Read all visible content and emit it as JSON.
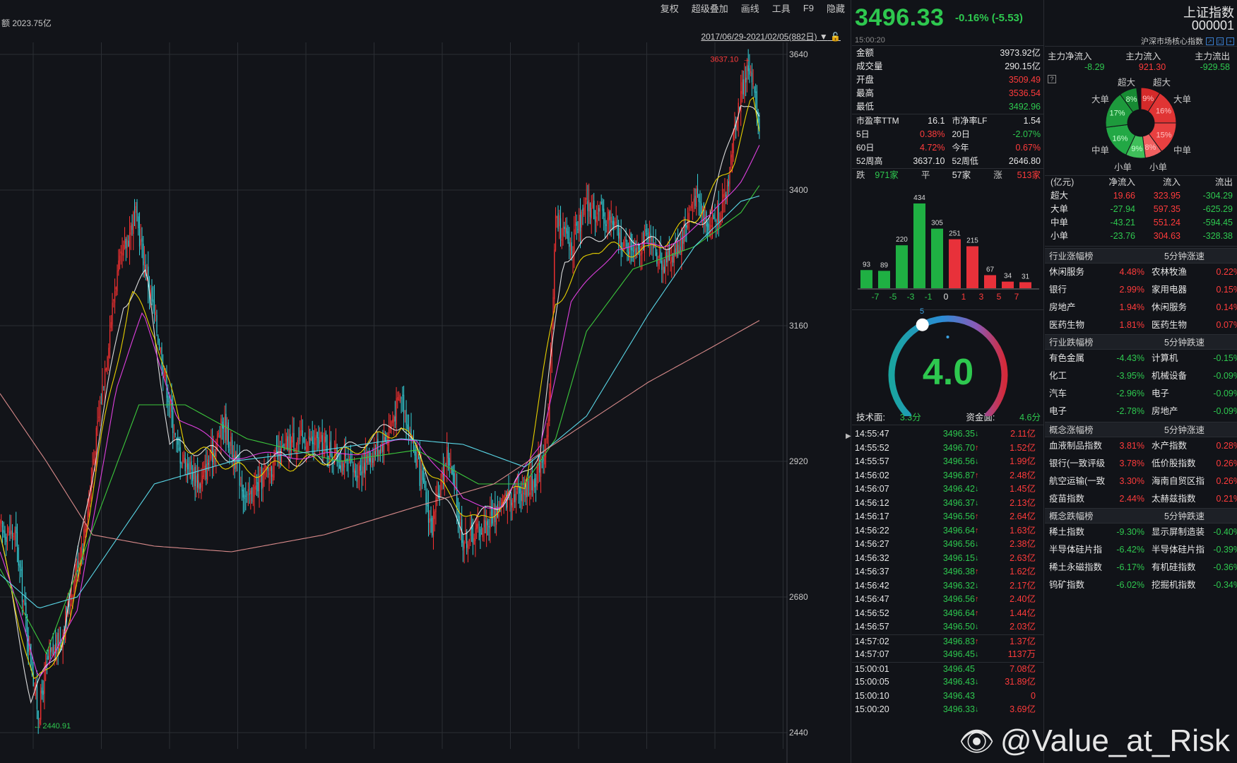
{
  "toolbar": {
    "items": [
      "复权",
      "超级叠加",
      "画线",
      "工具",
      "F9",
      "隐藏"
    ]
  },
  "chart_info": "额 2023.75亿",
  "date_range": "2017/06/29-2021/02/05(882日)",
  "chart_data": {
    "type": "candlestick",
    "y_ticks": [
      3640,
      3400,
      3160,
      2920,
      2680,
      2440
    ],
    "ylim": [
      2440,
      3640
    ],
    "high_label": "3637.10",
    "low_label": "2440.91",
    "close_path_anchors": [
      [
        0,
        2800
      ],
      [
        20,
        2790
      ],
      [
        35,
        2620
      ],
      [
        50,
        2470
      ],
      [
        60,
        2560
      ],
      [
        80,
        2610
      ],
      [
        110,
        2800
      ],
      [
        150,
        3240
      ],
      [
        175,
        3360
      ],
      [
        200,
        3180
      ],
      [
        230,
        2940
      ],
      [
        260,
        2880
      ],
      [
        290,
        2990
      ],
      [
        320,
        2850
      ],
      [
        345,
        2900
      ],
      [
        380,
        2960
      ],
      [
        420,
        2950
      ],
      [
        460,
        2900
      ],
      [
        500,
        2960
      ],
      [
        520,
        3040
      ],
      [
        540,
        2920
      ],
      [
        560,
        2800
      ],
      [
        580,
        2940
      ],
      [
        600,
        2780
      ],
      [
        630,
        2810
      ],
      [
        660,
        2860
      ],
      [
        690,
        2880
      ],
      [
        710,
        2960
      ],
      [
        720,
        3350
      ],
      [
        740,
        3300
      ],
      [
        760,
        3370
      ],
      [
        790,
        3350
      ],
      [
        810,
        3300
      ],
      [
        840,
        3310
      ],
      [
        860,
        3270
      ],
      [
        880,
        3300
      ],
      [
        900,
        3390
      ],
      [
        920,
        3340
      ],
      [
        940,
        3380
      ],
      [
        955,
        3540
      ],
      [
        970,
        3620
      ],
      [
        985,
        3510
      ]
    ],
    "ma_lines": [
      {
        "color": "#ffffff",
        "anchors": [
          [
            0,
            2790
          ],
          [
            40,
            2500
          ],
          [
            80,
            2600
          ],
          [
            120,
            2900
          ],
          [
            160,
            3200
          ],
          [
            190,
            3250
          ],
          [
            220,
            2950
          ],
          [
            300,
            2930
          ],
          [
            420,
            2920
          ],
          [
            520,
            2990
          ],
          [
            560,
            2880
          ],
          [
            600,
            2800
          ],
          [
            660,
            2860
          ],
          [
            700,
            2940
          ],
          [
            730,
            3280
          ],
          [
            790,
            3330
          ],
          [
            860,
            3300
          ],
          [
            920,
            3360
          ],
          [
            960,
            3560
          ],
          [
            985,
            3520
          ]
        ]
      },
      {
        "color": "#e8d100",
        "anchors": [
          [
            0,
            2780
          ],
          [
            45,
            2520
          ],
          [
            90,
            2620
          ],
          [
            130,
            2950
          ],
          [
            170,
            3220
          ],
          [
            200,
            3150
          ],
          [
            240,
            2950
          ],
          [
            320,
            2900
          ],
          [
            440,
            2930
          ],
          [
            520,
            2980
          ],
          [
            580,
            2860
          ],
          [
            620,
            2810
          ],
          [
            680,
            2880
          ],
          [
            720,
            3200
          ],
          [
            770,
            3300
          ],
          [
            840,
            3290
          ],
          [
            900,
            3350
          ],
          [
            950,
            3450
          ],
          [
            975,
            3560
          ],
          [
            985,
            3500
          ]
        ]
      },
      {
        "color": "#e040e0",
        "anchors": [
          [
            0,
            2760
          ],
          [
            50,
            2540
          ],
          [
            100,
            2650
          ],
          [
            150,
            3050
          ],
          [
            185,
            3180
          ],
          [
            230,
            3000
          ],
          [
            300,
            2930
          ],
          [
            440,
            2930
          ],
          [
            540,
            2960
          ],
          [
            600,
            2850
          ],
          [
            650,
            2840
          ],
          [
            700,
            2950
          ],
          [
            740,
            3200
          ],
          [
            800,
            3300
          ],
          [
            860,
            3300
          ],
          [
            920,
            3350
          ],
          [
            960,
            3420
          ],
          [
            985,
            3480
          ]
        ]
      },
      {
        "color": "#3cc83c",
        "anchors": [
          [
            0,
            2730
          ],
          [
            60,
            2580
          ],
          [
            120,
            2800
          ],
          [
            180,
            3020
          ],
          [
            240,
            3020
          ],
          [
            320,
            2960
          ],
          [
            440,
            2920
          ],
          [
            540,
            2940
          ],
          [
            620,
            2880
          ],
          [
            680,
            2880
          ],
          [
            720,
            2960
          ],
          [
            760,
            3150
          ],
          [
            820,
            3260
          ],
          [
            900,
            3300
          ],
          [
            960,
            3360
          ],
          [
            985,
            3410
          ]
        ]
      },
      {
        "color": "#5ad8e8",
        "anchors": [
          [
            0,
            2720
          ],
          [
            50,
            2660
          ],
          [
            100,
            2680
          ],
          [
            200,
            2880
          ],
          [
            300,
            2920
          ],
          [
            420,
            2940
          ],
          [
            520,
            2960
          ],
          [
            600,
            2950
          ],
          [
            680,
            2910
          ],
          [
            760,
            3000
          ],
          [
            840,
            3180
          ],
          [
            900,
            3300
          ],
          [
            960,
            3380
          ],
          [
            985,
            3390
          ]
        ]
      },
      {
        "color": "#d88a8a",
        "anchors": [
          [
            0,
            3040
          ],
          [
            60,
            2920
          ],
          [
            120,
            2790
          ],
          [
            200,
            2770
          ],
          [
            300,
            2760
          ],
          [
            420,
            2790
          ],
          [
            540,
            2840
          ],
          [
            640,
            2880
          ],
          [
            740,
            2970
          ],
          [
            840,
            3060
          ],
          [
            920,
            3120
          ],
          [
            985,
            3170
          ]
        ]
      }
    ]
  },
  "quote": {
    "price": "3496.33",
    "change": "-0.16% (-5.53)",
    "time": "15:00:20",
    "name": "上证指数",
    "code": "000001",
    "subtitle": "沪深市场核心指数"
  },
  "stats": [
    {
      "label": "金额",
      "value": "3973.92亿",
      "color": "white"
    },
    {
      "label": "成交量",
      "value": "290.15亿",
      "color": "white"
    },
    {
      "label": "开盘",
      "value": "3509.49",
      "color": "red"
    },
    {
      "label": "最高",
      "value": "3536.54",
      "color": "red"
    },
    {
      "label": "最低",
      "value": "3492.96",
      "color": "green"
    }
  ],
  "stats2": [
    [
      {
        "label": "市盈率TTM",
        "value": "16.1",
        "color": "white"
      },
      {
        "label": "市净率LF",
        "value": "1.54",
        "color": "white"
      }
    ],
    [
      {
        "label": "5日",
        "value": "0.38%",
        "color": "red"
      },
      {
        "label": "20日",
        "value": "-2.07%",
        "color": "green"
      }
    ],
    [
      {
        "label": "60日",
        "value": "4.72%",
        "color": "red"
      },
      {
        "label": "今年",
        "value": "0.67%",
        "color": "red"
      }
    ],
    [
      {
        "label": "52周高",
        "value": "3637.10",
        "color": "white"
      },
      {
        "label": "52周低",
        "value": "2646.80",
        "color": "white"
      }
    ]
  ],
  "breadth": {
    "down_label": "跌",
    "down": "971家",
    "flat_label": "平",
    "flat": "57家",
    "up_label": "涨",
    "up": "513家"
  },
  "distribution": {
    "values": [
      93,
      89,
      220,
      434,
      305,
      251,
      215,
      67,
      34,
      31
    ],
    "colors": [
      "green",
      "green",
      "green",
      "green",
      "green",
      "red",
      "red",
      "red",
      "red",
      "red"
    ],
    "axis_labels": [
      "-7",
      "-5",
      "-3",
      "-1",
      "0",
      "1",
      "3",
      "5",
      "7"
    ]
  },
  "gauge": {
    "value": "4.0",
    "min": "0",
    "max": "10",
    "mid": "5",
    "level": 4.0,
    "tech_label": "技术面:",
    "tech_value": "3.3分",
    "fund_label": "资金面:",
    "fund_value": "4.6分"
  },
  "ticks": [
    {
      "time": "14:55:47",
      "price": "3496.35",
      "dir": "down",
      "vol": "2.11亿"
    },
    {
      "time": "14:55:52",
      "price": "3496.70",
      "dir": "up",
      "vol": "1.52亿"
    },
    {
      "time": "14:55:57",
      "price": "3496.56",
      "dir": "down",
      "vol": "1.99亿"
    },
    {
      "time": "14:56:02",
      "price": "3496.87",
      "dir": "up",
      "vol": "2.48亿"
    },
    {
      "time": "14:56:07",
      "price": "3496.42",
      "dir": "down",
      "vol": "1.45亿"
    },
    {
      "time": "14:56:12",
      "price": "3496.37",
      "dir": "down",
      "vol": "2.13亿"
    },
    {
      "time": "14:56:17",
      "price": "3496.56",
      "dir": "up",
      "vol": "2.64亿"
    },
    {
      "time": "14:56:22",
      "price": "3496.64",
      "dir": "up",
      "vol": "1.63亿"
    },
    {
      "time": "14:56:27",
      "price": "3496.56",
      "dir": "down",
      "vol": "2.38亿"
    },
    {
      "time": "14:56:32",
      "price": "3496.15",
      "dir": "down",
      "vol": "2.63亿"
    },
    {
      "time": "14:56:37",
      "price": "3496.38",
      "dir": "up",
      "vol": "1.62亿"
    },
    {
      "time": "14:56:42",
      "price": "3496.32",
      "dir": "down",
      "vol": "2.17亿"
    },
    {
      "time": "14:56:47",
      "price": "3496.56",
      "dir": "up",
      "vol": "2.40亿"
    },
    {
      "time": "14:56:52",
      "price": "3496.64",
      "dir": "up",
      "vol": "1.44亿"
    },
    {
      "time": "14:56:57",
      "price": "3496.50",
      "dir": "down",
      "vol": "2.03亿"
    },
    {
      "time": "14:57:02",
      "price": "3496.83",
      "dir": "up",
      "vol": "1.37亿"
    },
    {
      "time": "14:57:07",
      "price": "3496.45",
      "dir": "down",
      "vol": "1137万"
    },
    {
      "time": "15:00:01",
      "price": "3496.45",
      "dir": "",
      "vol": "7.08亿"
    },
    {
      "time": "15:00:05",
      "price": "3496.43",
      "dir": "down",
      "vol": "31.89亿"
    },
    {
      "time": "15:00:10",
      "price": "3496.43",
      "dir": "",
      "vol": "0"
    },
    {
      "time": "15:00:20",
      "price": "3496.33",
      "dir": "down",
      "vol": "3.69亿"
    }
  ],
  "main_flow": {
    "labels": [
      "主力净流入",
      "主力流入",
      "主力流出"
    ],
    "values": [
      "-8.29",
      "921.30",
      "-929.58"
    ],
    "colors": [
      "green",
      "red",
      "green"
    ]
  },
  "donut": {
    "segments": [
      {
        "pct": 9,
        "color": "#d42a2a",
        "label": "9%"
      },
      {
        "pct": 16,
        "color": "#e03434",
        "label": "16%"
      },
      {
        "pct": 15,
        "color": "#e84040",
        "label": "15%"
      },
      {
        "pct": 8,
        "color": "#f06060",
        "label": "8%"
      },
      {
        "pct": 9,
        "color": "#3fbf5a",
        "label": "9%"
      },
      {
        "pct": 16,
        "color": "#22a845",
        "label": "16%"
      },
      {
        "pct": 17,
        "color": "#1d9a3c",
        "label": "17%"
      },
      {
        "pct": 8,
        "color": "#178a33",
        "label": "8%"
      }
    ],
    "outer_labels": {
      "top_l": "超大",
      "top_r": "超大",
      "left_t": "大单",
      "right_t": "大单",
      "left_b": "中单",
      "right_b": "中单",
      "bot_l": "小单",
      "bot_r": "小单"
    }
  },
  "flow_table": {
    "headers": [
      "(亿元)",
      "净流入",
      "流入",
      "流出"
    ],
    "rows": [
      {
        "name": "超大",
        "net": "19.66",
        "in": "323.95",
        "out": "-304.29",
        "net_color": "red"
      },
      {
        "name": "大单",
        "net": "-27.94",
        "in": "597.35",
        "out": "-625.29",
        "net_color": "green"
      },
      {
        "name": "中单",
        "net": "-43.21",
        "in": "551.24",
        "out": "-594.45",
        "net_color": "green"
      },
      {
        "name": "小单",
        "net": "-23.76",
        "in": "304.63",
        "out": "-328.38",
        "net_color": "green"
      }
    ]
  },
  "sections": [
    {
      "title": "行业涨幅榜",
      "right": "5分钟涨速",
      "rows": [
        [
          "休闲服务",
          "4.48%",
          "农林牧渔",
          "0.22%",
          "red",
          "red"
        ],
        [
          "银行",
          "2.99%",
          "家用电器",
          "0.15%",
          "red",
          "red"
        ],
        [
          "房地产",
          "1.94%",
          "休闲服务",
          "0.14%",
          "red",
          "red"
        ],
        [
          "医药生物",
          "1.81%",
          "医药生物",
          "0.07%",
          "red",
          "red"
        ]
      ]
    },
    {
      "title": "行业跌幅榜",
      "right": "5分钟跌速",
      "rows": [
        [
          "有色金属",
          "-4.43%",
          "计算机",
          "-0.15%",
          "green",
          "green"
        ],
        [
          "化工",
          "-3.95%",
          "机械设备",
          "-0.09%",
          "green",
          "green"
        ],
        [
          "汽车",
          "-2.96%",
          "电子",
          "-0.09%",
          "green",
          "green"
        ],
        [
          "电子",
          "-2.78%",
          "房地产",
          "-0.09%",
          "green",
          "green"
        ]
      ]
    },
    {
      "title": "概念涨幅榜",
      "right": "5分钟涨速",
      "rows": [
        [
          "血液制品指数",
          "3.81%",
          "水产指数",
          "0.28%",
          "red",
          "red"
        ],
        [
          "银行(一致评级",
          "3.78%",
          "低价股指数",
          "0.26%",
          "red",
          "red"
        ],
        [
          "航空运输(一致",
          "3.30%",
          "海南自贸区指",
          "0.26%",
          "red",
          "red"
        ],
        [
          "疫苗指数",
          "2.44%",
          "太赫兹指数",
          "0.21%",
          "red",
          "red"
        ]
      ]
    },
    {
      "title": "概念跌幅榜",
      "right": "5分钟跌速",
      "rows": [
        [
          "稀土指数",
          "-9.30%",
          "显示屏制造装",
          "-0.40%",
          "green",
          "green"
        ],
        [
          "半导体硅片指",
          "-6.42%",
          "半导体硅片指",
          "-0.39%",
          "green",
          "green"
        ],
        [
          "稀土永磁指数",
          "-6.17%",
          "有机硅指数",
          "-0.36%",
          "green",
          "green"
        ],
        [
          "钨矿指数",
          "-6.02%",
          "挖掘机指数",
          "-0.34%",
          "green",
          "green"
        ]
      ]
    }
  ],
  "watermark": "@Value_at_Risk"
}
